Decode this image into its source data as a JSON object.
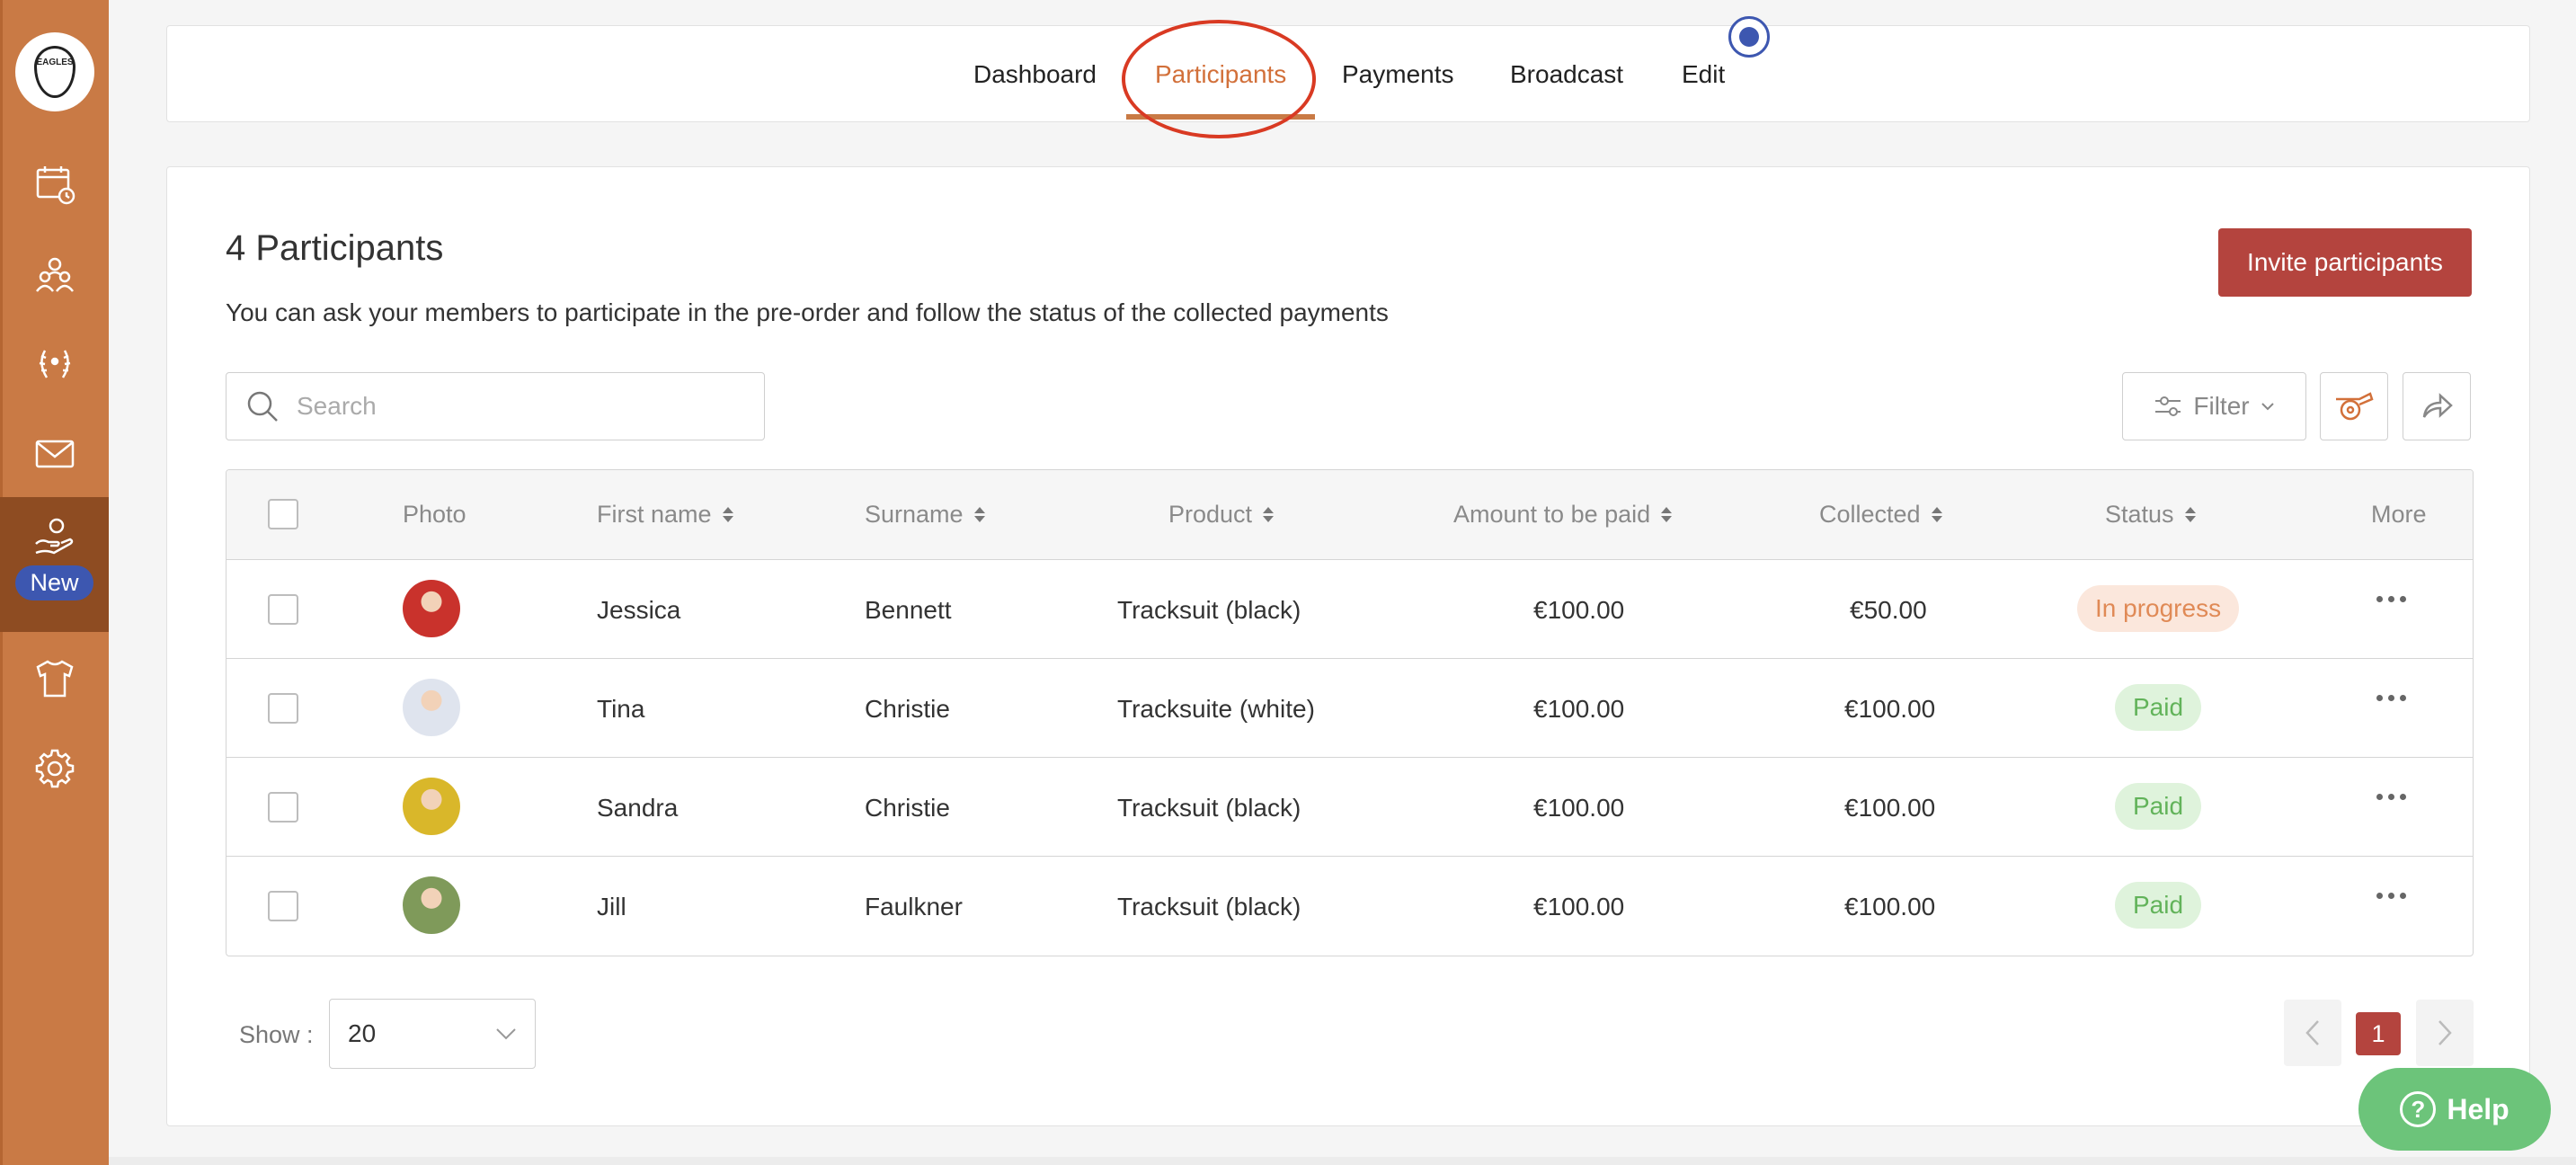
{
  "sidebar": {
    "logo_text": "EAGLES",
    "items": [
      {
        "name": "calendar",
        "icon": "calendar-clock-icon"
      },
      {
        "name": "members",
        "icon": "people-icon"
      },
      {
        "name": "competitions",
        "icon": "laurel-icon"
      },
      {
        "name": "messages",
        "icon": "mail-icon"
      },
      {
        "name": "collections",
        "icon": "hand-coin-icon",
        "badge": "New",
        "active": true
      },
      {
        "name": "shop",
        "icon": "tshirt-icon"
      },
      {
        "name": "settings",
        "icon": "gear-icon"
      }
    ]
  },
  "tabs": [
    {
      "label": "Dashboard",
      "active": false
    },
    {
      "label": "Participants",
      "active": true
    },
    {
      "label": "Payments",
      "active": false
    },
    {
      "label": "Broadcast",
      "active": false
    },
    {
      "label": "Edit",
      "active": false
    }
  ],
  "main": {
    "title": "4 Participants",
    "subtitle": "You can ask your members to participate in the pre-order and follow the status of the collected payments",
    "invite_label": "Invite participants",
    "search_placeholder": "Search",
    "filter_label": "Filter"
  },
  "table": {
    "columns": [
      "Photo",
      "First name",
      "Surname",
      "Product",
      "Amount to be paid",
      "Collected",
      "Status",
      "More"
    ],
    "rows": [
      {
        "first": "Jessica",
        "surname": "Bennett",
        "product": "Tracksuit (black)",
        "amount": "€100.00",
        "collected": "€50.00",
        "status": "In progress",
        "status_type": "progress",
        "avatar_color": "#c9322c"
      },
      {
        "first": "Tina",
        "surname": "Christie",
        "product": "Tracksuite (white)",
        "amount": "€100.00",
        "collected": "€100.00",
        "status": "Paid",
        "status_type": "paid",
        "avatar_color": "#dfe4ee"
      },
      {
        "first": "Sandra",
        "surname": "Christie",
        "product": "Tracksuit (black)",
        "amount": "€100.00",
        "collected": "€100.00",
        "status": "Paid",
        "status_type": "paid",
        "avatar_color": "#d9b72a"
      },
      {
        "first": "Jill",
        "surname": "Faulkner",
        "product": "Tracksuit (black)",
        "amount": "€100.00",
        "collected": "€100.00",
        "status": "Paid",
        "status_type": "paid",
        "avatar_color": "#7f9a5a"
      }
    ]
  },
  "footer": {
    "show_label": "Show :",
    "page_size": "20",
    "current_page": "1",
    "help_label": "Help"
  },
  "colors": {
    "sidebar": "#c97a45",
    "sidebar_active": "#8e4c22",
    "accent": "#d2703a",
    "primary_button": "#b4443e",
    "new_badge": "#3d57b0",
    "help": "#6cc47a",
    "annotation_ellipse": "#d93a23"
  }
}
